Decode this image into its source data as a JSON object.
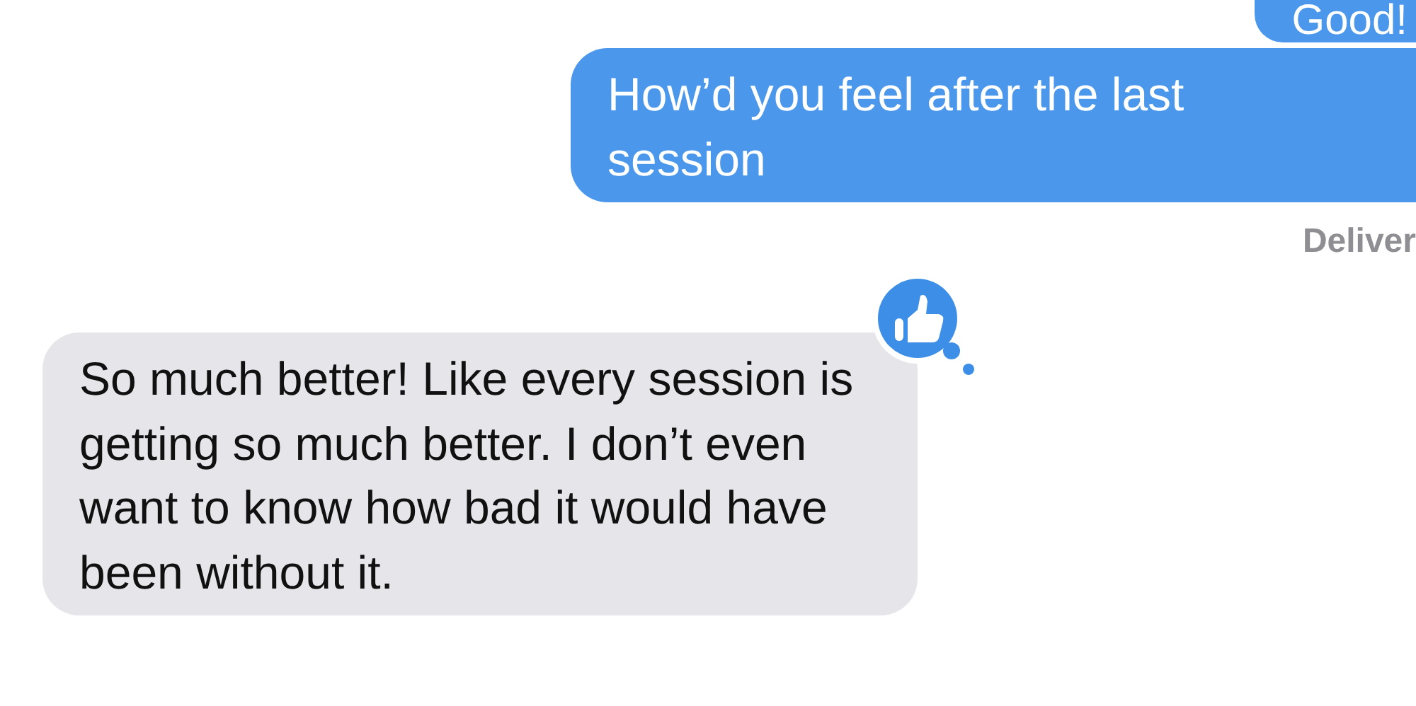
{
  "messages": [
    {
      "kind": "outgoing",
      "text": "Good!"
    },
    {
      "kind": "outgoing",
      "text": "How’d you feel after the last session"
    },
    {
      "kind": "status",
      "text": "Deliver"
    },
    {
      "kind": "incoming",
      "text": "So much better! Like every session is getting so much better. I don’t even want to know how bad it would have been without it.",
      "liked": true
    }
  ]
}
